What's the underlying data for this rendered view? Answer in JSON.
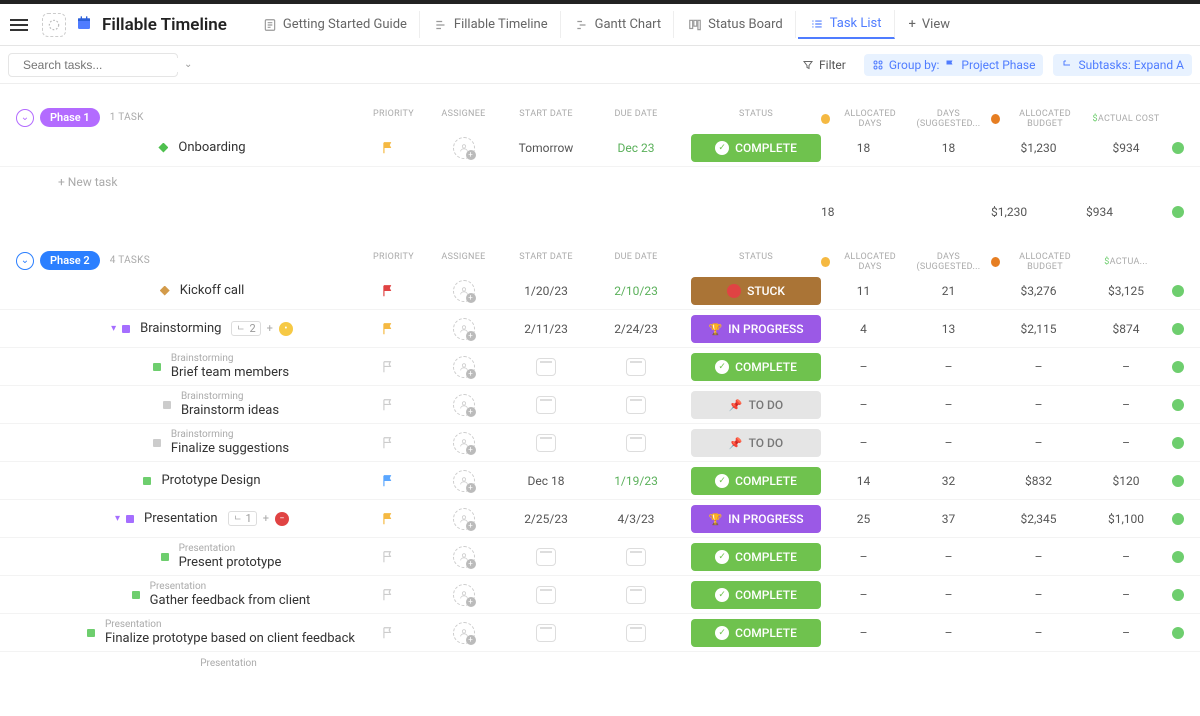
{
  "page_title": "Fillable Timeline",
  "view_tabs": [
    {
      "label": "Getting Started Guide"
    },
    {
      "label": "Fillable Timeline"
    },
    {
      "label": "Gantt Chart"
    },
    {
      "label": "Status Board"
    },
    {
      "label": "Task List",
      "active": true
    },
    {
      "label": "View",
      "type": "add"
    }
  ],
  "search": {
    "placeholder": "Search tasks..."
  },
  "toolbar": {
    "filter": "Filter",
    "groupby_label": "Group by:",
    "groupby_value": "Project Phase",
    "subtasks": "Subtasks: Expand A"
  },
  "columns": {
    "priority": "PRIORITY",
    "assignee": "ASSIGNEE",
    "start": "START DATE",
    "due": "DUE DATE",
    "status": "STATUS",
    "alloc_days": "ALLOCATED DAYS",
    "sugg_days": "DAYS (SUGGESTED...",
    "budget": "ALLOCATED BUDGET",
    "cost": "ACTUAL COST",
    "cost_short": "ACTUA..."
  },
  "new_task": "+ New task",
  "groups": [
    {
      "name": "Phase 1",
      "color": "purple",
      "count": "1 TASK",
      "summary": {
        "alloc_days": "18",
        "budget": "$1,230",
        "cost": "$934"
      },
      "tasks": [
        {
          "name": "Onboarding",
          "bullet": "green",
          "priority": "yellow",
          "start": "Tomorrow",
          "due": "Dec 23",
          "due_style": "green",
          "status": "COMPLETE",
          "status_type": "complete",
          "alloc_days": "18",
          "sugg_days": "18",
          "budget": "$1,230",
          "cost": "$934"
        }
      ]
    },
    {
      "name": "Phase 2",
      "color": "blue",
      "count": "4 TASKS",
      "tasks": [
        {
          "name": "Kickoff call",
          "bullet": "orange",
          "priority": "red",
          "start": "1/20/23",
          "due": "2/10/23",
          "due_style": "green",
          "status": "STUCK",
          "status_type": "stuck",
          "alloc_days": "11",
          "sugg_days": "21",
          "budget": "$3,276",
          "cost": "$3,125"
        },
        {
          "name": "Brainstorming",
          "bullet": "purple",
          "expandable": true,
          "priority": "yellow",
          "start": "2/11/23",
          "due": "2/24/23",
          "due_style": "dark",
          "status": "IN PROGRESS",
          "status_type": "progress",
          "alloc_days": "4",
          "sugg_days": "13",
          "budget": "$2,115",
          "cost": "$874",
          "subtask_count": "2",
          "subtask_badge": "yellow",
          "children": [
            {
              "parent": "Brainstorming",
              "name": "Brief team members",
              "bullet": "greenf",
              "status": "COMPLETE",
              "status_type": "complete"
            },
            {
              "parent": "Brainstorming",
              "name": "Brainstorm ideas",
              "bullet": "grey",
              "status": "TO DO",
              "status_type": "todo"
            },
            {
              "parent": "Brainstorming",
              "name": "Finalize suggestions",
              "bullet": "grey",
              "status": "TO DO",
              "status_type": "todo"
            }
          ]
        },
        {
          "name": "Prototype Design",
          "bullet": "greenf",
          "priority": "blue",
          "start": "Dec 18",
          "due": "1/19/23",
          "due_style": "green",
          "status": "COMPLETE",
          "status_type": "complete",
          "alloc_days": "14",
          "sugg_days": "32",
          "budget": "$832",
          "cost": "$120"
        },
        {
          "name": "Presentation",
          "bullet": "purple",
          "expandable": true,
          "priority": "yellow",
          "start": "2/25/23",
          "due": "4/3/23",
          "due_style": "dark",
          "status": "IN PROGRESS",
          "status_type": "progress",
          "alloc_days": "25",
          "sugg_days": "37",
          "budget": "$2,345",
          "cost": "$1,100",
          "subtask_count": "1",
          "subtask_badge": "red",
          "children": [
            {
              "parent": "Presentation",
              "name": "Present prototype",
              "bullet": "greenf",
              "status": "COMPLETE",
              "status_type": "complete"
            },
            {
              "parent": "Presentation",
              "name": "Gather feedback from client",
              "bullet": "greenf",
              "status": "COMPLETE",
              "status_type": "complete"
            },
            {
              "parent": "Presentation",
              "name": "Finalize prototype based on client feedback",
              "bullet": "greenf",
              "status": "COMPLETE",
              "status_type": "complete"
            },
            {
              "parent": "Presentation",
              "name": "",
              "bullet": "none",
              "partial": true
            }
          ]
        }
      ]
    }
  ]
}
